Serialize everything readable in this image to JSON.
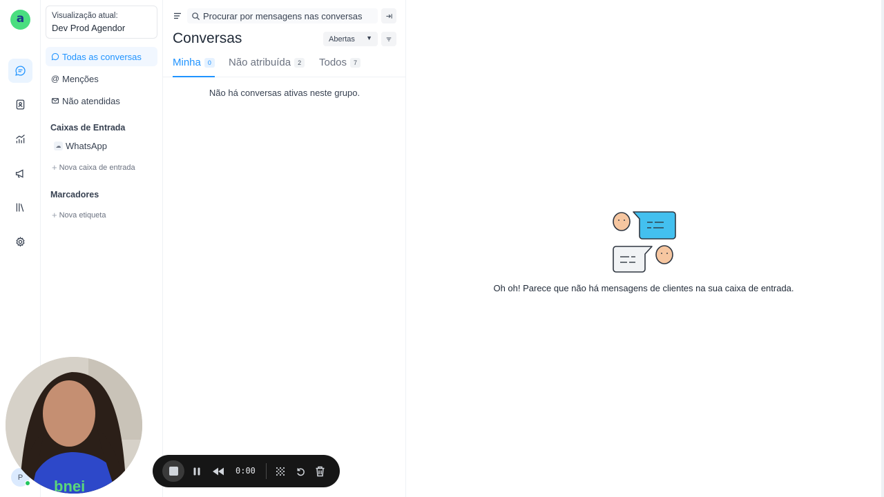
{
  "app": {
    "logo_letter": "a",
    "brand_color": "#1f93ff"
  },
  "rail": {
    "items": [
      {
        "name": "conversations",
        "icon": "chat-icon",
        "active": true
      },
      {
        "name": "contacts",
        "icon": "contact-book-icon"
      },
      {
        "name": "reports",
        "icon": "chart-icon"
      },
      {
        "name": "campaigns",
        "icon": "megaphone-icon"
      },
      {
        "name": "library",
        "icon": "library-icon"
      },
      {
        "name": "settings",
        "icon": "gear-icon"
      }
    ],
    "avatar_initial": "P"
  },
  "sidebar": {
    "view_label": "Visualização atual:",
    "view_name": "Dev Prod Agendor",
    "nav": [
      {
        "label": "Todas as conversas",
        "icon": "chat-icon",
        "active": true
      },
      {
        "label": "Menções",
        "icon": "at-icon"
      },
      {
        "label": "Não atendidas",
        "icon": "mail-icon"
      }
    ],
    "inboxes_heading": "Caixas de Entrada",
    "inboxes": [
      {
        "label": "WhatsApp",
        "icon": "cloud-icon"
      }
    ],
    "new_inbox": "Nova caixa de entrada",
    "labels_heading": "Marcadores",
    "new_label": "Nova etiqueta"
  },
  "list": {
    "search_placeholder": "Procurar por mensagens nas conversas",
    "title": "Conversas",
    "status_filter": "Abertas",
    "tabs": [
      {
        "label": "Minha",
        "count": "0",
        "active": true
      },
      {
        "label": "Não atribuída",
        "count": "2"
      },
      {
        "label": "Todos",
        "count": "7"
      }
    ],
    "empty_message": "Não há conversas ativas neste grupo."
  },
  "main": {
    "empty_message": "Oh oh! Parece que não há mensagens de clientes na sua caixa de entrada.",
    "illustration": "two-people-chatting-icon"
  },
  "recorder": {
    "time": "0:00"
  }
}
